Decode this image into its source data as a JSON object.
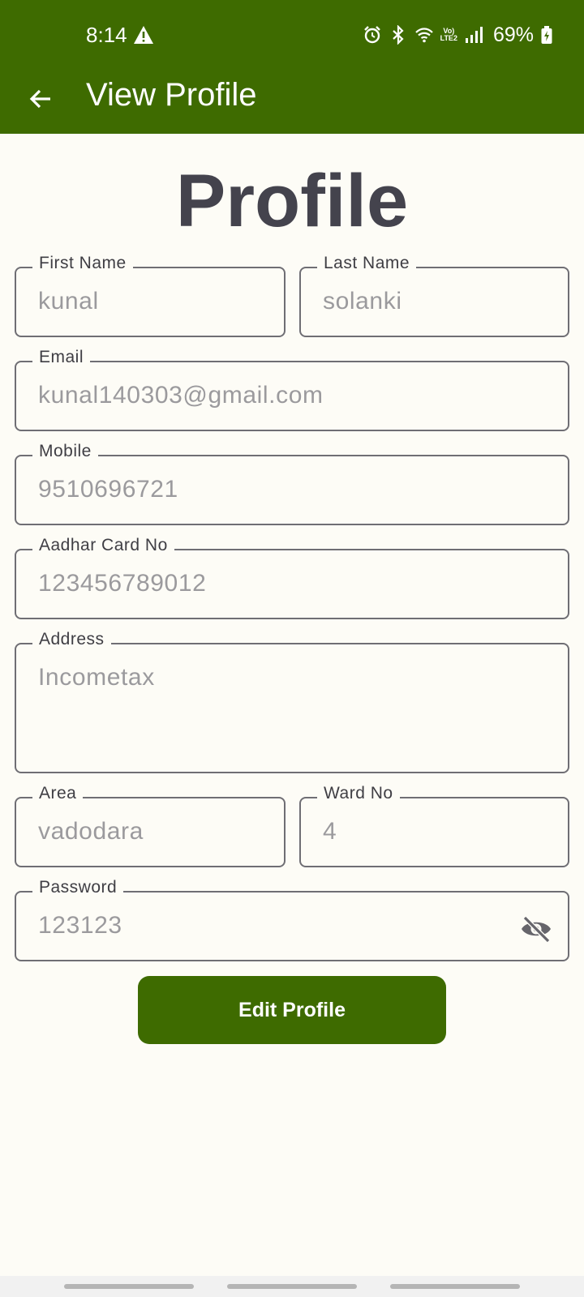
{
  "status_bar": {
    "time": "8:14",
    "lte_line1": "Vo)",
    "lte_line2": "LTE2",
    "battery_percent": "69%",
    "icons": [
      "warning-icon",
      "alarm-icon",
      "bluetooth-icon",
      "wifi-icon",
      "signal-icon",
      "battery-icon"
    ]
  },
  "toolbar": {
    "title": "View Profile",
    "back_icon": "arrow-left-icon"
  },
  "page": {
    "title": "Profile"
  },
  "form": {
    "first_name": {
      "label": "First Name",
      "value": "kunal"
    },
    "last_name": {
      "label": "Last Name",
      "value": "solanki"
    },
    "email": {
      "label": "Email",
      "value": "kunal140303@gmail.com"
    },
    "mobile": {
      "label": "Mobile",
      "value": "9510696721"
    },
    "aadhar": {
      "label": "Aadhar Card No",
      "value": "123456789012"
    },
    "address": {
      "label": "Address",
      "value": "Incometax"
    },
    "area": {
      "label": "Area",
      "value": "vadodara"
    },
    "ward": {
      "label": "Ward No",
      "value": "4"
    },
    "password": {
      "label": "Password",
      "value": "123123",
      "toggle_icon": "eye-off-icon"
    }
  },
  "actions": {
    "edit_label": "Edit Profile"
  },
  "colors": {
    "primary": "#3e6b00",
    "background": "#fdfcf6",
    "title_text": "#44434d",
    "field_border": "#6f6e74",
    "value_text": "#9b9a9d"
  }
}
